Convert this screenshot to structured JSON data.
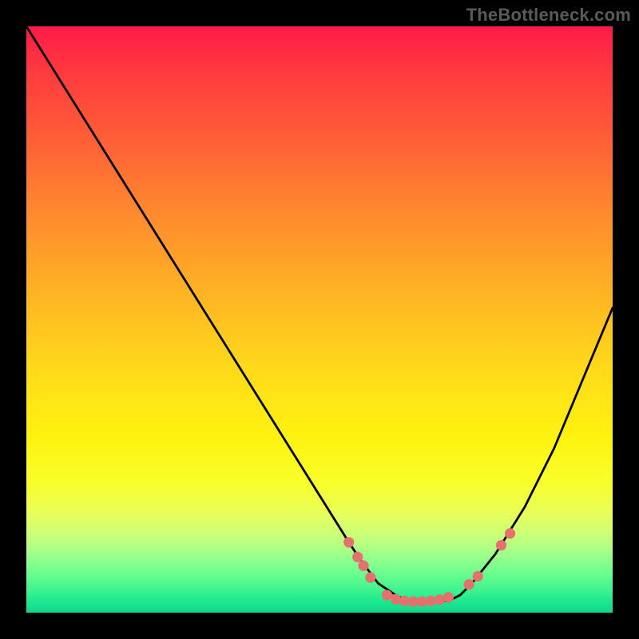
{
  "watermark": "TheBottleneck.com",
  "chart_data": {
    "type": "line",
    "title": "",
    "xlabel": "",
    "ylabel": "",
    "xlim": [
      0,
      100
    ],
    "ylim": [
      0,
      100
    ],
    "grid": false,
    "legend": false,
    "note": "Axis values are normalized 0–100; no tick labels are visible in the source image.",
    "series": [
      {
        "name": "curve",
        "color": "#000000",
        "x": [
          0,
          5,
          10,
          15,
          20,
          25,
          30,
          35,
          40,
          45,
          50,
          55,
          57,
          60,
          63,
          65,
          67,
          70,
          72,
          74,
          76,
          80,
          85,
          90,
          95,
          100
        ],
        "y": [
          100,
          92,
          84,
          76,
          68,
          60,
          52,
          44,
          36,
          28,
          20,
          12,
          9,
          5,
          3,
          2,
          2,
          2,
          2,
          3,
          5,
          10,
          18,
          28,
          40,
          52
        ]
      }
    ],
    "markers": {
      "name": "dots",
      "color": "#e4716e",
      "radius_pct": 0.9,
      "points": [
        {
          "x": 55.0,
          "y": 12.0
        },
        {
          "x": 56.5,
          "y": 9.5
        },
        {
          "x": 57.5,
          "y": 8.0
        },
        {
          "x": 58.7,
          "y": 6.0
        },
        {
          "x": 61.5,
          "y": 3.0
        },
        {
          "x": 63.0,
          "y": 2.3
        },
        {
          "x": 64.5,
          "y": 2.0
        },
        {
          "x": 66.0,
          "y": 1.9
        },
        {
          "x": 67.5,
          "y": 1.9
        },
        {
          "x": 69.0,
          "y": 2.0
        },
        {
          "x": 70.5,
          "y": 2.2
        },
        {
          "x": 72.0,
          "y": 2.6
        },
        {
          "x": 75.5,
          "y": 4.8
        },
        {
          "x": 77.0,
          "y": 6.2
        },
        {
          "x": 81.0,
          "y": 11.5
        },
        {
          "x": 82.5,
          "y": 13.5
        }
      ]
    }
  }
}
